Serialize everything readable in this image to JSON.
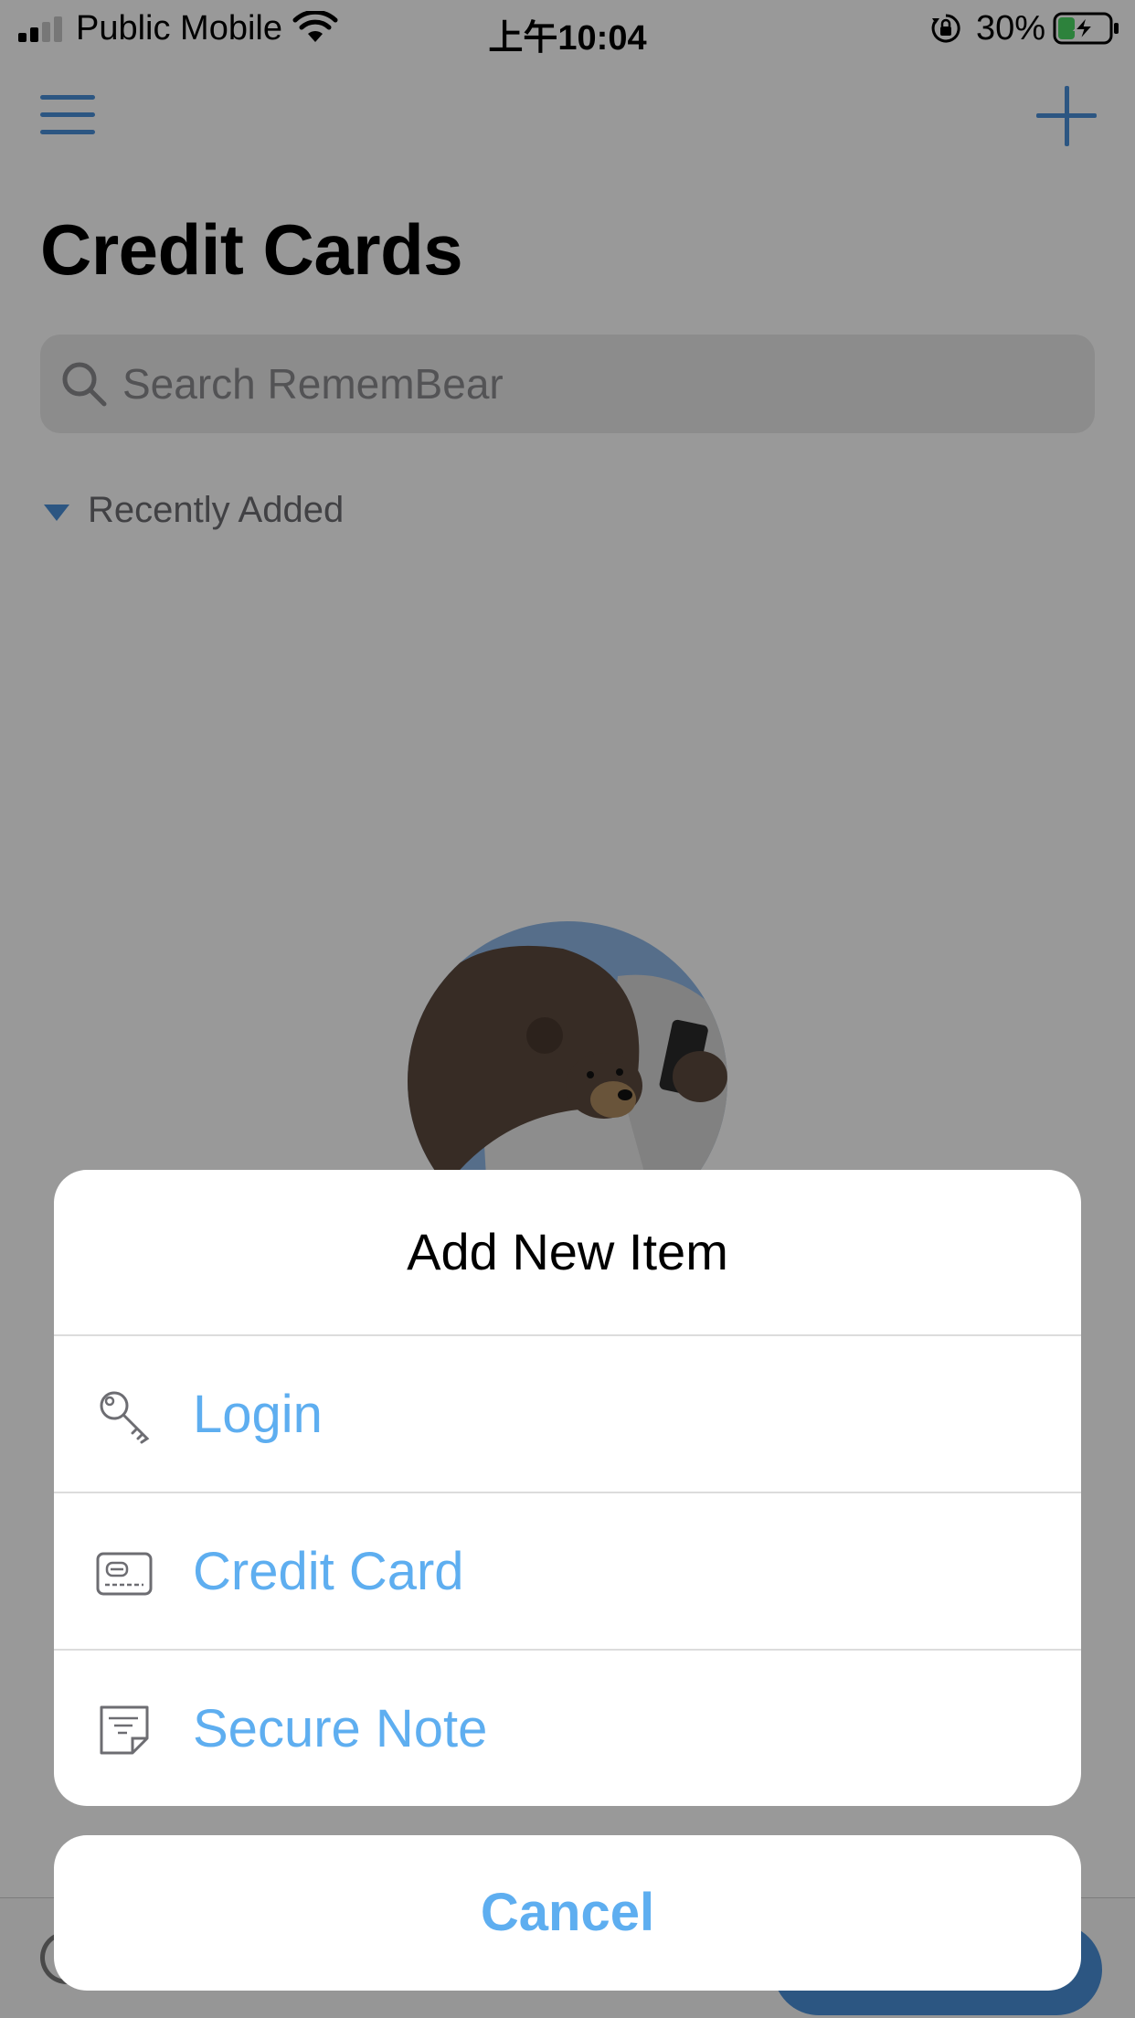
{
  "status_bar": {
    "carrier": "Public Mobile",
    "time": "上午10:04",
    "battery_percent": "30%",
    "signal_bars_active": 2,
    "signal_bars_total": 4,
    "battery_level": 0.3,
    "charging": true,
    "icons": [
      "signal-icon",
      "wifi-icon",
      "orientation-lock-icon",
      "battery-charging-icon"
    ]
  },
  "nav": {
    "menu_icon": "hamburger-menu-icon",
    "add_icon": "plus-icon"
  },
  "page": {
    "title": "Credit Cards"
  },
  "search": {
    "placeholder": "Search RememBear"
  },
  "section": {
    "label": "Recently Added",
    "expanded": true
  },
  "illustration": {
    "name": "bear-with-phone-illustration"
  },
  "action_sheet": {
    "title": "Add New Item",
    "items": [
      {
        "label": "Login",
        "icon": "key-icon"
      },
      {
        "label": "Credit Card",
        "icon": "credit-card-icon"
      },
      {
        "label": "Secure Note",
        "icon": "note-icon"
      }
    ],
    "cancel_label": "Cancel"
  },
  "colors": {
    "accent": "#4a90d9",
    "sheet_text": "#5eaef0",
    "overlay": "rgba(0,0,0,0.40)"
  }
}
